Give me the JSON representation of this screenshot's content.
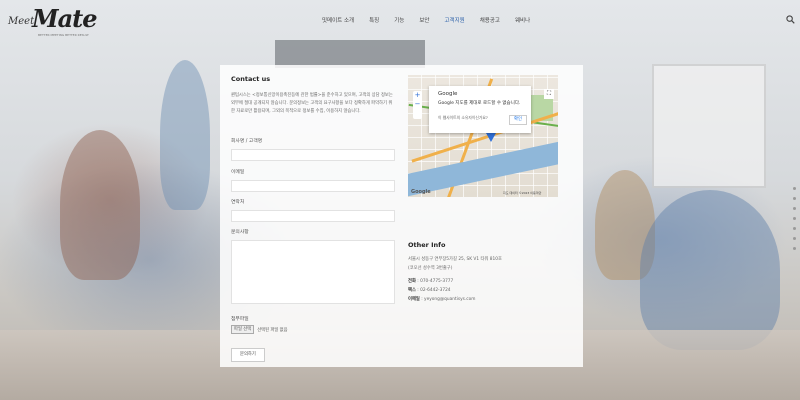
{
  "header": {
    "logo": {
      "small": "Meet",
      "big": "Mate",
      "tagline": "BETTER MEETING BETTER RESULT"
    },
    "nav": [
      "밋메이트 소개",
      "특징",
      "기능",
      "보안",
      "고객지원",
      "채용공고",
      "웨비나"
    ],
    "active_nav_index": 4,
    "search_icon": "search-icon"
  },
  "contact": {
    "title": "Contact us",
    "intro": "퀀텀시스는 <정보통신망이용촉진등에 관한 법률>을 준수하고 있으며, 고객의 상담 정보는 외부에 절대 공개되지 않습니다. 문의정보는 고객의 요구사항을 보다 정확하게 파악하기 위한 자료로만 활용되며, 그외의 목적으로 정보를 수집, 이용하지 않습니다.",
    "fields": [
      {
        "label": "회사명 / 고객명",
        "value": ""
      },
      {
        "label": "이메일",
        "value": ""
      },
      {
        "label": "연락처",
        "value": ""
      },
      {
        "label": "문의사항",
        "value": ""
      }
    ],
    "attach_label": "첨부파일",
    "file_button": "파일 선택",
    "file_status": "선택된 파일 없음",
    "submit": "문의하기"
  },
  "map": {
    "dialog_title": "Google",
    "dialog_message": "Google 지도를 제대로 로드할 수 없습니다.",
    "dialog_question": "이 웹사이트의 소유자이신가요?",
    "dialog_ok": "확인",
    "zoom_in": "+",
    "zoom_out": "−",
    "google_label": "Google",
    "attribution": "지도 데이터 ©2023  이용약관"
  },
  "other_info": {
    "title": "Other Info",
    "address_line1": "서울시 성동구 연무장5가길 25, SK V1 타워 810호",
    "address_line2": "(코오선 성수역 3번출구)",
    "phone_label": "전화",
    "phone_value": ": 070-4775-3777",
    "fax_label": "팩스",
    "fax_value": ": 02-6442-3724",
    "email_label": "이메일",
    "email_value": ": yeyong@quantisys.com"
  },
  "colors": {
    "accent": "#2a5fa8",
    "map_water": "#8fb7d9",
    "map_road": "#f0b04a"
  }
}
